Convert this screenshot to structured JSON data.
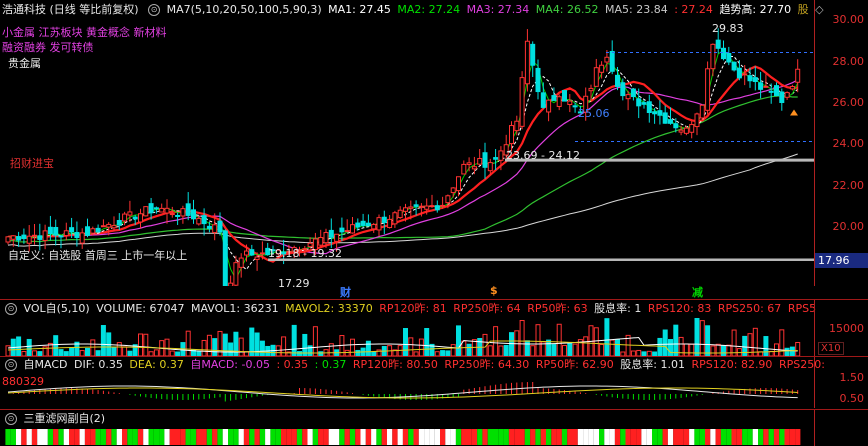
{
  "header": {
    "title": "浩通科技 (日线 等比前复权)",
    "ma_name": "MA7(5,10,20,50,100,5,90,3)",
    "ma1": "MA1: 27.45",
    "ma2": "MA2: 27.24",
    "ma3": "MA3: 27.34",
    "ma4": "MA4: 26.52",
    "ma5": "MA5: 23.84",
    "ma6": ": 27.24",
    "trend": "趋势高: 27.70",
    "gufang": "股",
    "colors": {
      "ma1": "#ffffff",
      "ma2": "#00e000",
      "ma3": "#e040e0",
      "ma4": "#30c030",
      "ma5": "#c8c8c8",
      "ma6": "#ff3030",
      "trend": "#ffffff"
    }
  },
  "tags": {
    "line1": "小金属 江苏板块 黄金概念 新材料",
    "line2": "融资融券 发可转债",
    "line3": "贵金属",
    "left_note": "招财进宝",
    "custom": "自定义: 自选股 首周三 上市一年以上"
  },
  "annotations": {
    "high": "29.83",
    "mid_range": "23.69 - 24.12",
    "low_range": "19.18 - 19.32",
    "low": "17.29",
    "mid_tag": "25.06",
    "price_tag": "17.96"
  },
  "events": [
    {
      "label": "财",
      "color": "#3b7bff"
    },
    {
      "label": "$",
      "color": "#ff9020"
    },
    {
      "label": "减",
      "color": "#00d000"
    }
  ],
  "price_axis": [
    "30.00",
    "28.00",
    "26.00",
    "24.00",
    "22.00",
    "20.00"
  ],
  "volume": {
    "title": "VOL自(5,10)",
    "volume": "VOLUME: 67047",
    "mavol1": "MAVOL1: 36231",
    "mavol2": "MAVOL2: 33370",
    "rpx": "RP120昨: 81",
    "rp250": "RP250昨: 64",
    "rp50": "RP50昨: 63",
    "xi": "股息率: 1",
    "rps120": "RPS120: 83",
    "rps250": "RPS250: 67",
    "rps5": "RPS5",
    "axis": "15000",
    "x10": "X10"
  },
  "macd": {
    "title": "自MACD",
    "dif": "DIF: 0.35",
    "dea": "DEA: 0.37",
    "macd": "自MACD: -0.05",
    "v1": ": 0.35",
    "v2": ": 0.37",
    "rp120": "RP120昨: 80.50",
    "rp250": "RP250昨: 64.30",
    "rp50": "RP50昨: 62.90",
    "xi": "股息率: 1.01",
    "rps120": "RPS120: 82.90",
    "rps250": "RPS250:",
    "num": "880329",
    "axis_top": "1.50",
    "axis_bot": "0.50"
  },
  "triple": {
    "title": "三重滤网副自(2)"
  }
}
